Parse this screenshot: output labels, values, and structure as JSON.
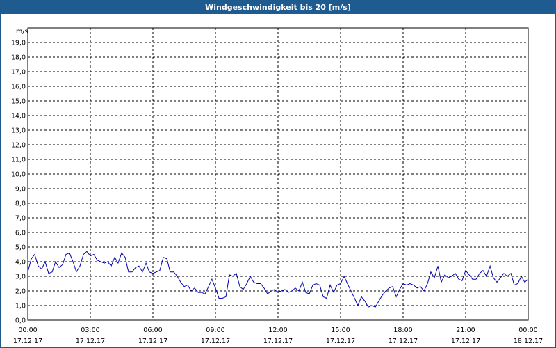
{
  "window": {
    "title": "Windgeschwindigkeit bis 20 [m/s]"
  },
  "colors": {
    "titlebar": "#1d5b91",
    "line": "#0000aa",
    "grid": "#000000"
  },
  "chart_data": {
    "type": "line",
    "title": "Windgeschwindigkeit bis 20 [m/s]",
    "ylabel": "m/s",
    "ylim": [
      0,
      20
    ],
    "y_ticks": [
      "0,0",
      "1,0",
      "2,0",
      "3,0",
      "4,0",
      "5,0",
      "6,0",
      "7,0",
      "8,0",
      "9,0",
      "10,0",
      "11,0",
      "12,0",
      "13,0",
      "14,0",
      "15,0",
      "16,0",
      "17,0",
      "18,0",
      "19,0"
    ],
    "x_ticks": [
      {
        "time": "00:00",
        "date": "17.12.17"
      },
      {
        "time": "03:00",
        "date": "17.12.17"
      },
      {
        "time": "06:00",
        "date": "17.12.17"
      },
      {
        "time": "09:00",
        "date": "17.12.17"
      },
      {
        "time": "12:00",
        "date": "17.12.17"
      },
      {
        "time": "15:00",
        "date": "17.12.17"
      },
      {
        "time": "18:00",
        "date": "17.12.17"
      },
      {
        "time": "21:00",
        "date": "17.12.17"
      },
      {
        "time": "00:00",
        "date": "18.12.17"
      }
    ],
    "xlim_hours": [
      0,
      24
    ],
    "grid": true,
    "series": [
      {
        "values": [
          [
            0.0,
            3.3
          ],
          [
            0.17,
            4.2
          ],
          [
            0.33,
            4.5
          ],
          [
            0.5,
            3.7
          ],
          [
            0.67,
            3.5
          ],
          [
            0.83,
            4.0
          ],
          [
            1.0,
            3.2
          ],
          [
            1.17,
            3.3
          ],
          [
            1.33,
            4.0
          ],
          [
            1.5,
            3.6
          ],
          [
            1.67,
            3.8
          ],
          [
            1.83,
            4.5
          ],
          [
            2.0,
            4.6
          ],
          [
            2.17,
            4.0
          ],
          [
            2.33,
            3.3
          ],
          [
            2.5,
            3.7
          ],
          [
            2.67,
            4.5
          ],
          [
            2.83,
            4.7
          ],
          [
            3.0,
            4.4
          ],
          [
            3.17,
            4.5
          ],
          [
            3.33,
            4.1
          ],
          [
            3.5,
            4.0
          ],
          [
            3.67,
            3.9
          ],
          [
            3.83,
            4.0
          ],
          [
            4.0,
            3.7
          ],
          [
            4.17,
            4.3
          ],
          [
            4.33,
            3.9
          ],
          [
            4.5,
            4.6
          ],
          [
            4.67,
            4.3
          ],
          [
            4.83,
            3.3
          ],
          [
            5.0,
            3.3
          ],
          [
            5.17,
            3.6
          ],
          [
            5.33,
            3.7
          ],
          [
            5.5,
            3.3
          ],
          [
            5.67,
            3.9
          ],
          [
            5.83,
            3.3
          ],
          [
            6.0,
            3.2
          ],
          [
            6.17,
            3.3
          ],
          [
            6.33,
            3.4
          ],
          [
            6.5,
            4.3
          ],
          [
            6.67,
            4.2
          ],
          [
            6.83,
            3.3
          ],
          [
            7.0,
            3.3
          ],
          [
            7.17,
            3.0
          ],
          [
            7.33,
            2.6
          ],
          [
            7.5,
            2.3
          ],
          [
            7.67,
            2.4
          ],
          [
            7.83,
            2.0
          ],
          [
            8.0,
            2.2
          ],
          [
            8.17,
            1.9
          ],
          [
            8.33,
            1.9
          ],
          [
            8.5,
            1.8
          ],
          [
            8.67,
            2.3
          ],
          [
            8.83,
            2.8
          ],
          [
            9.0,
            2.2
          ],
          [
            9.17,
            1.5
          ],
          [
            9.33,
            1.5
          ],
          [
            9.5,
            1.6
          ],
          [
            9.67,
            3.1
          ],
          [
            9.83,
            3.0
          ],
          [
            10.0,
            3.2
          ],
          [
            10.17,
            2.3
          ],
          [
            10.33,
            2.1
          ],
          [
            10.5,
            2.5
          ],
          [
            10.67,
            3.0
          ],
          [
            10.83,
            2.6
          ],
          [
            11.0,
            2.5
          ],
          [
            11.17,
            2.5
          ],
          [
            11.33,
            2.2
          ],
          [
            11.5,
            1.8
          ],
          [
            11.67,
            2.0
          ],
          [
            11.83,
            2.1
          ],
          [
            12.0,
            1.9
          ],
          [
            12.17,
            2.0
          ],
          [
            12.33,
            2.1
          ],
          [
            12.5,
            1.9
          ],
          [
            12.67,
            2.0
          ],
          [
            12.83,
            2.2
          ],
          [
            13.0,
            2.0
          ],
          [
            13.17,
            2.6
          ],
          [
            13.33,
            1.9
          ],
          [
            13.5,
            1.8
          ],
          [
            13.67,
            2.4
          ],
          [
            13.83,
            2.5
          ],
          [
            14.0,
            2.4
          ],
          [
            14.17,
            1.6
          ],
          [
            14.33,
            1.5
          ],
          [
            14.5,
            2.4
          ],
          [
            14.67,
            1.9
          ],
          [
            14.83,
            2.4
          ],
          [
            15.0,
            2.5
          ],
          [
            15.17,
            3.0
          ],
          [
            15.33,
            2.5
          ],
          [
            15.5,
            2.0
          ],
          [
            15.67,
            1.5
          ],
          [
            15.83,
            1.0
          ],
          [
            16.0,
            1.6
          ],
          [
            16.17,
            1.3
          ],
          [
            16.33,
            0.9
          ],
          [
            16.5,
            1.0
          ],
          [
            16.67,
            0.9
          ],
          [
            16.83,
            1.3
          ],
          [
            17.0,
            1.7
          ],
          [
            17.17,
            2.0
          ],
          [
            17.33,
            2.2
          ],
          [
            17.5,
            2.3
          ],
          [
            17.67,
            1.6
          ],
          [
            17.83,
            2.1
          ],
          [
            18.0,
            2.5
          ],
          [
            18.17,
            2.4
          ],
          [
            18.33,
            2.5
          ],
          [
            18.5,
            2.4
          ],
          [
            18.67,
            2.2
          ],
          [
            18.83,
            2.3
          ],
          [
            19.0,
            2.0
          ],
          [
            19.17,
            2.5
          ],
          [
            19.33,
            3.3
          ],
          [
            19.5,
            2.9
          ],
          [
            19.67,
            3.7
          ],
          [
            19.83,
            2.6
          ],
          [
            20.0,
            3.1
          ],
          [
            20.17,
            2.9
          ],
          [
            20.33,
            3.0
          ],
          [
            20.5,
            3.2
          ],
          [
            20.67,
            2.8
          ],
          [
            20.83,
            2.7
          ],
          [
            21.0,
            3.4
          ],
          [
            21.17,
            3.1
          ],
          [
            21.33,
            2.8
          ],
          [
            21.5,
            2.8
          ],
          [
            21.67,
            3.2
          ],
          [
            21.83,
            3.4
          ],
          [
            22.0,
            3.0
          ],
          [
            22.17,
            3.7
          ],
          [
            22.33,
            2.9
          ],
          [
            22.5,
            2.6
          ],
          [
            22.67,
            2.9
          ],
          [
            22.83,
            3.2
          ],
          [
            23.0,
            3.0
          ],
          [
            23.17,
            3.2
          ],
          [
            23.33,
            2.4
          ],
          [
            23.5,
            2.5
          ],
          [
            23.67,
            3.0
          ],
          [
            23.83,
            2.6
          ],
          [
            24.0,
            2.8
          ]
        ]
      }
    ]
  }
}
